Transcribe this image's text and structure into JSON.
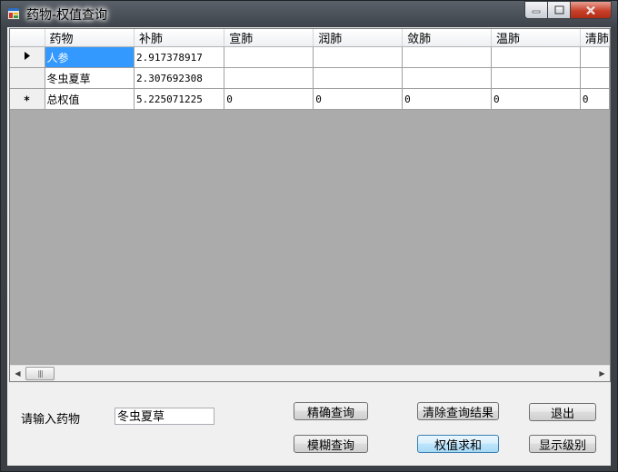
{
  "window": {
    "title": "药物-权值查询",
    "icon": "app-form-icon",
    "caption": {
      "minimize": "minimize-icon",
      "maximize": "maximize-icon",
      "close": "close-icon"
    }
  },
  "grid": {
    "columns": [
      "药物",
      "补肺",
      "宣肺",
      "润肺",
      "敛肺",
      "温肺",
      "清肺"
    ],
    "rows": [
      {
        "marker": "current-row-arrow",
        "cells": [
          "人参",
          "2.917378917",
          "",
          "",
          "",
          "",
          ""
        ]
      },
      {
        "marker": "",
        "cells": [
          "冬虫夏草",
          "2.307692308",
          "",
          "",
          "",
          "",
          ""
        ]
      },
      {
        "marker": "new-row-star",
        "cells": [
          "总权值",
          "5.225071225",
          "0",
          "0",
          "0",
          "0",
          "0"
        ]
      }
    ],
    "selected_cell": "人参"
  },
  "form": {
    "input_label": "请输入药物",
    "input_value": "冬虫夏草",
    "buttons": {
      "exact_query": "精确查询",
      "clear_results": "清除查询结果",
      "exit": "退出",
      "fuzzy_query": "模糊查询",
      "sum_weights": "权值求和",
      "show_level": "显示级别"
    }
  },
  "colors": {
    "selection": "#3399ff",
    "grid_background": "#ababab",
    "form_background": "#f0f0f0"
  }
}
